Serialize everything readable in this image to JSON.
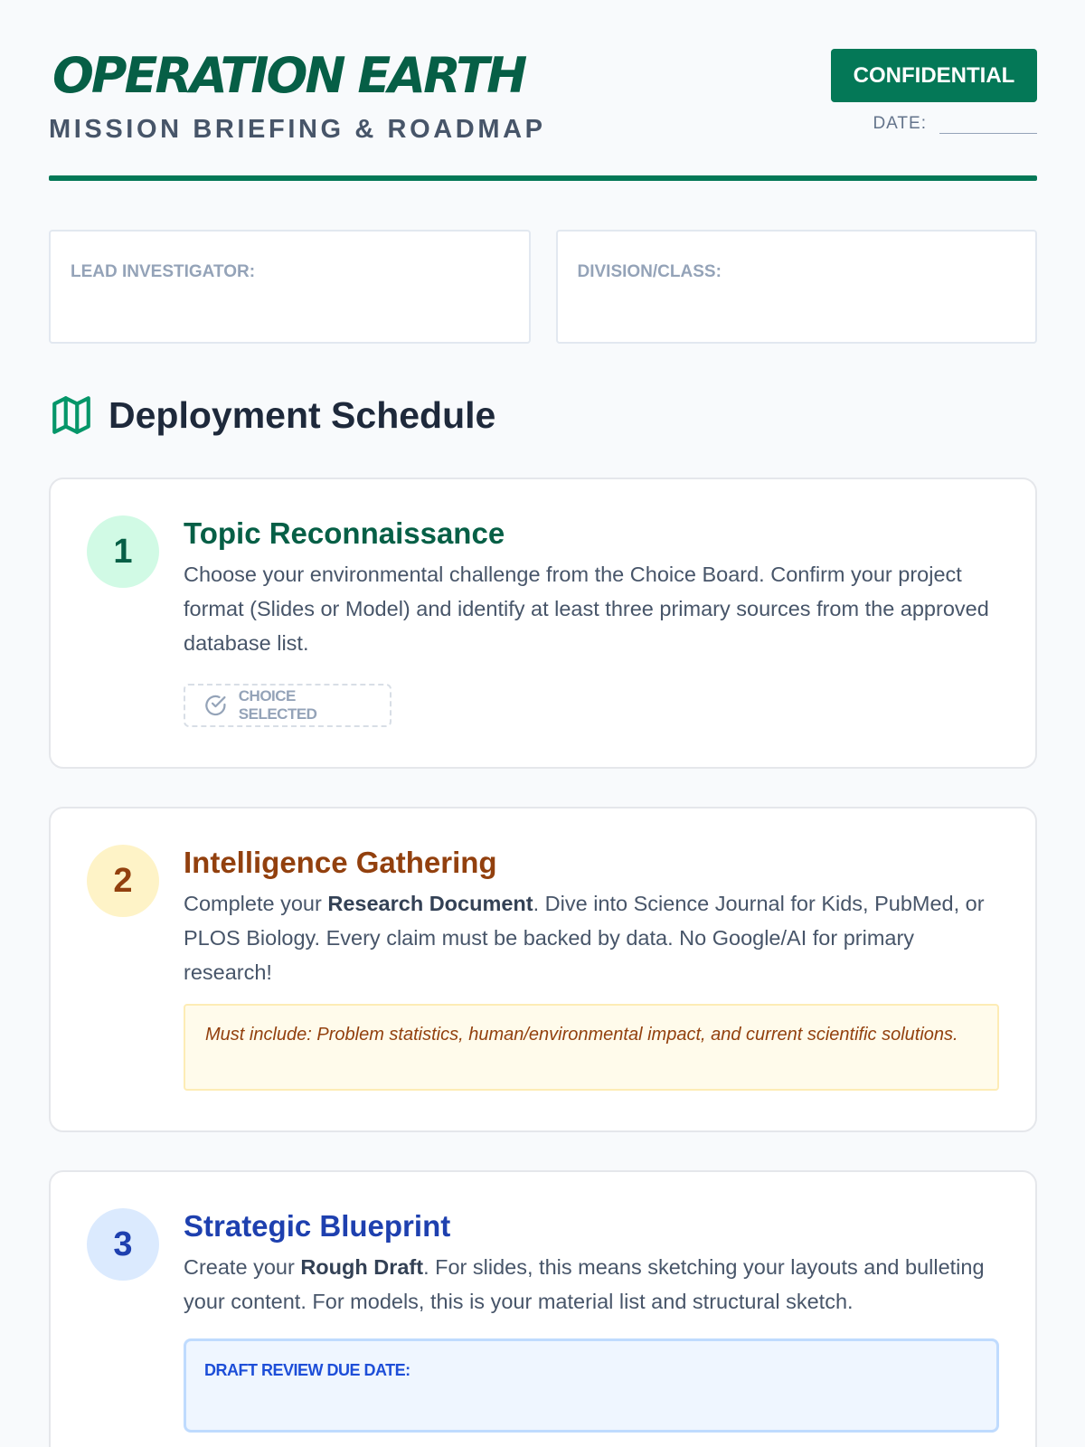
{
  "header": {
    "title": "OPERATION EARTH",
    "subtitle": "MISSION BRIEFING & ROADMAP",
    "badge": "CONFIDENTIAL",
    "date_label": "DATE:"
  },
  "info": {
    "lead_label": "LEAD INVESTIGATOR:",
    "division_label": "DIVISION/CLASS:"
  },
  "section": {
    "title": "Deployment Schedule",
    "icon": "map-icon"
  },
  "steps": [
    {
      "number": "1",
      "title": "Topic Reconnaissance",
      "text": "Choose your environmental challenge from the Choice Board. Confirm your project format (Slides or Model) and identify at least three primary sources from the approved database list.",
      "tag": "CHOICE SELECTED",
      "tag_icon": "check-circle-icon"
    },
    {
      "number": "2",
      "title": "Intelligence Gathering",
      "text_before": "Complete your ",
      "text_bold": "Research Document",
      "text_after": ". Dive into Science Journal for Kids, PubMed, or PLOS Biology. Every claim must be backed by data. No Google/AI for primary research!",
      "note": "Must include: Problem statistics, human/environmental impact, and current scientific solutions."
    },
    {
      "number": "3",
      "title": "Strategic Blueprint",
      "text_before": "Create your ",
      "text_bold": "Rough Draft",
      "text_after": ". For slides, this means sketching your layouts and bulleting your content. For models, this is your material list and structural sketch.",
      "due_label": "DRAFT REVIEW DUE DATE:"
    }
  ],
  "colors": {
    "brand_green": "#047857",
    "step1": "#065f46",
    "step2": "#92400e",
    "step3": "#1e40af"
  }
}
